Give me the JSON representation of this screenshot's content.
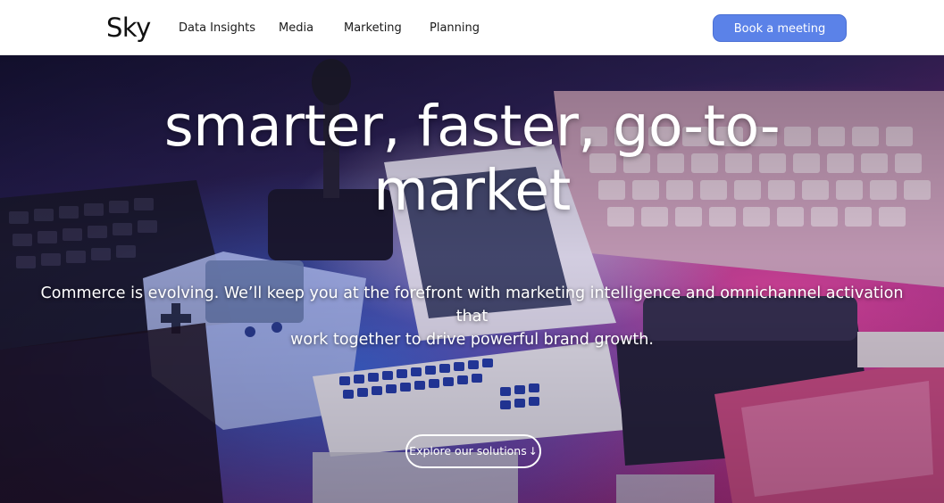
{
  "header": {
    "logo": "Sky",
    "nav": [
      {
        "label": "Data Insights"
      },
      {
        "label": "Media"
      },
      {
        "label": "Marketing"
      },
      {
        "label": "Planning"
      }
    ],
    "cta_label": "Book a meeting",
    "cta_color": "#5b82e8"
  },
  "hero": {
    "title_line1": "smarter, faster, go-to-",
    "title_line2": "market",
    "subtitle_line1": "Commerce is evolving. We’ll keep you at the forefront with marketing intelligence and omnichannel activation that",
    "subtitle_line2": "work together to drive powerful brand growth.",
    "button_label": "Explore our solutions",
    "button_icon": "arrow-down-icon",
    "background_image": "retro computers and game consoles under pink and blue neon light",
    "accent_colors": [
      "#ff3fa6",
      "#3f7bff"
    ]
  }
}
